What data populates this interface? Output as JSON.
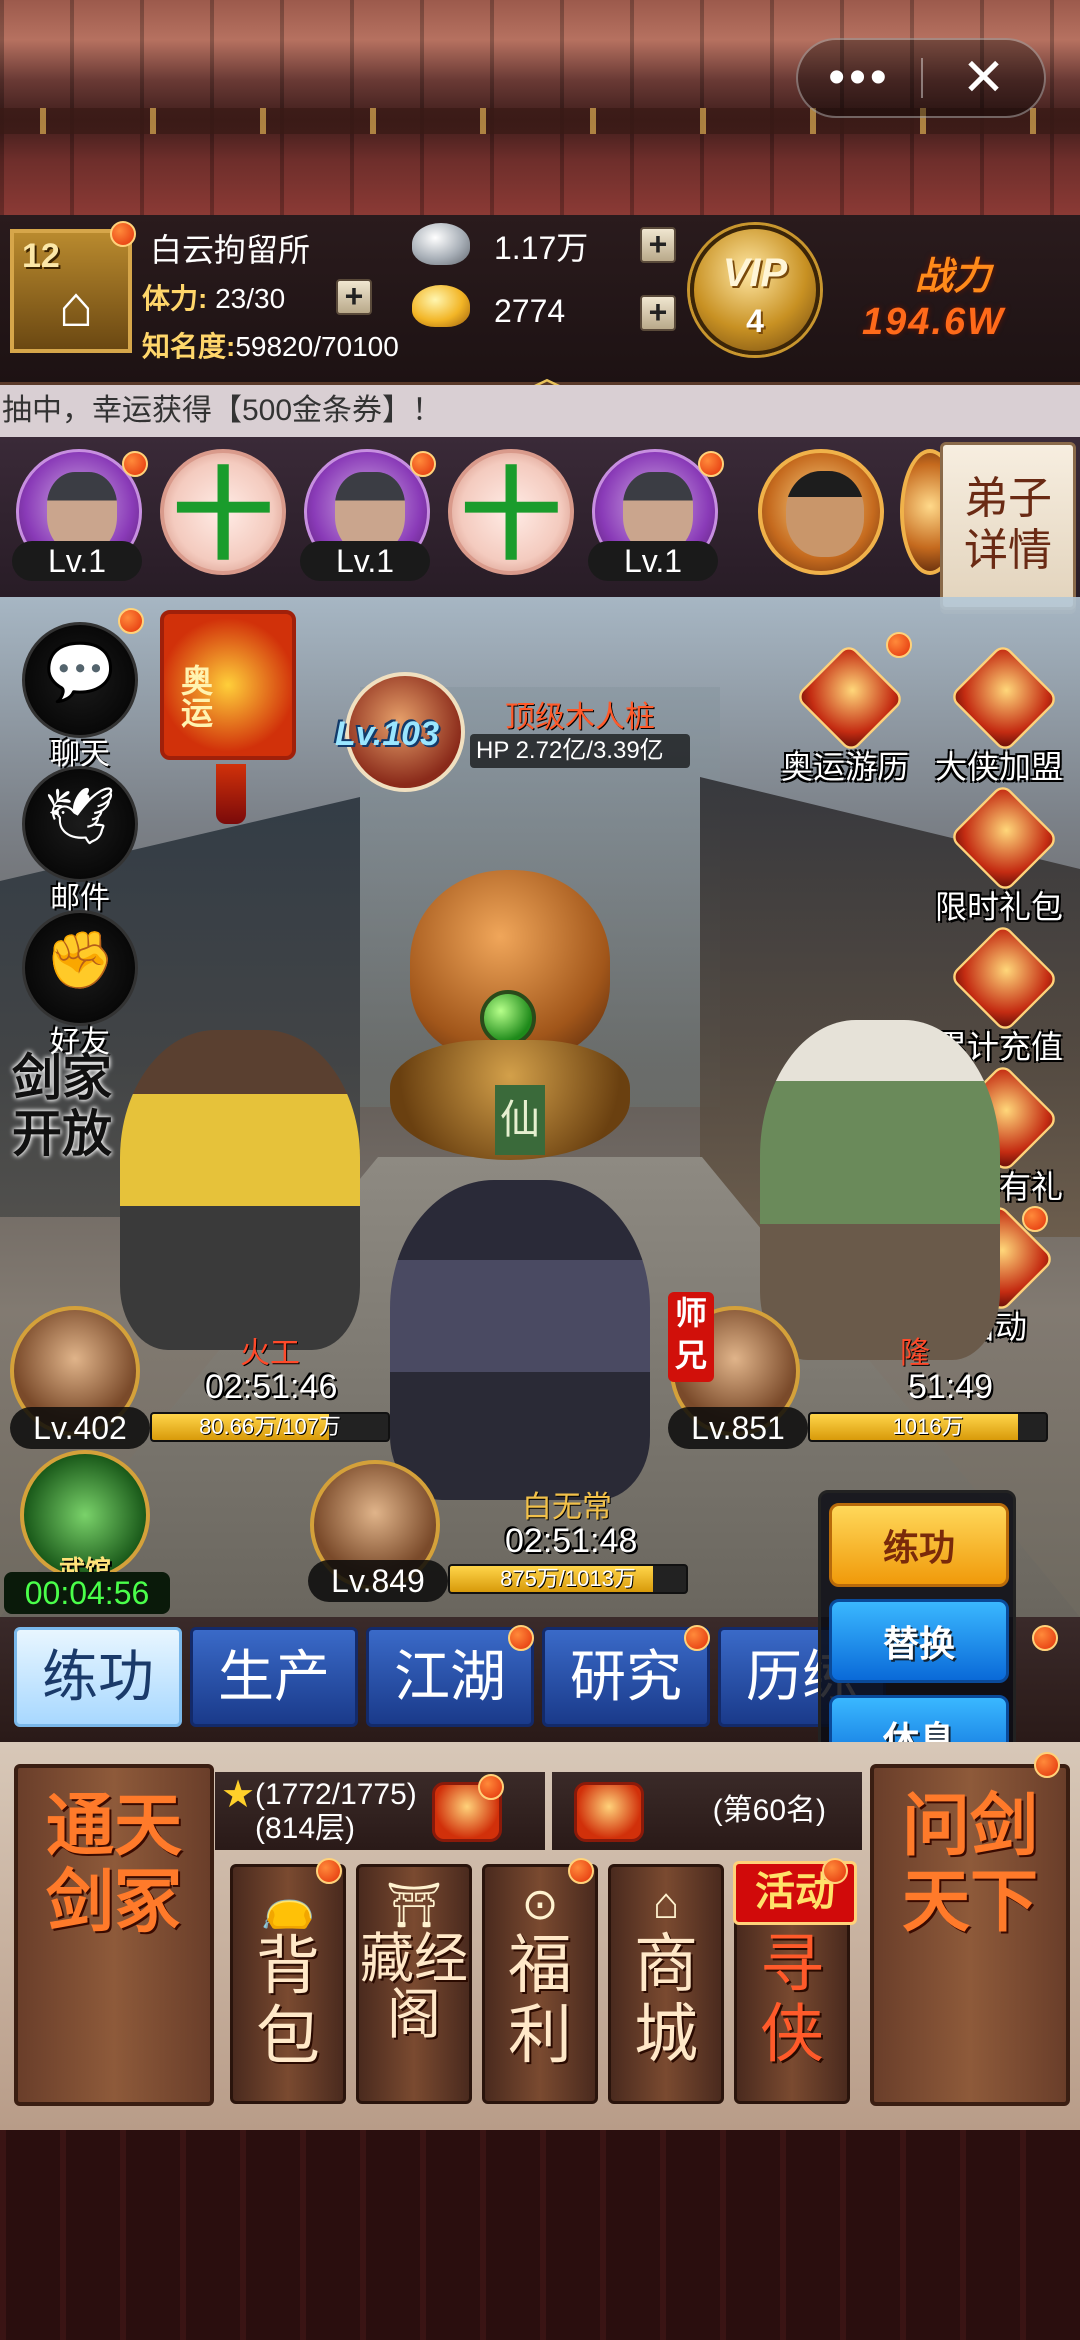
{
  "window_controls": {
    "more": "•••",
    "close": "✕"
  },
  "player": {
    "level": "12",
    "name": "白云拘留所",
    "stamina_label": "体力:",
    "stamina_value": "23/30",
    "fame_label": "知名度:",
    "fame_value": "59820/70100"
  },
  "currency": {
    "silver": "1.17万",
    "gold": "2774",
    "plus": "+"
  },
  "vip": {
    "label": "VIP",
    "level": "4"
  },
  "power": {
    "label": "战力",
    "value": "194.6W"
  },
  "marquee": "抽中，幸运获得【500金条券】！",
  "disciples": {
    "slots": [
      {
        "type": "hero",
        "level": "Lv.1"
      },
      {
        "type": "add",
        "symbol": "十"
      },
      {
        "type": "hero",
        "level": "Lv.1"
      },
      {
        "type": "add",
        "symbol": "十"
      },
      {
        "type": "hero",
        "level": "Lv.1"
      },
      {
        "type": "rare"
      }
    ],
    "detail_button": "弟子详情"
  },
  "left_menu": [
    {
      "label": "聊天",
      "icon": "chat-icon"
    },
    {
      "label": "邮件",
      "icon": "dove-icon"
    },
    {
      "label": "好友",
      "icon": "fist-icon"
    }
  ],
  "sword_logo": "剑家开放",
  "olympic_badge": "奥运",
  "boss": {
    "level": "Lv.103",
    "name": "顶级木人桩",
    "hp": "HP 2.72亿/3.39亿"
  },
  "right_menu": [
    {
      "label": "奥运游历"
    },
    {
      "label": "大侠加盟"
    },
    {
      "label": "限时礼包"
    },
    {
      "label": "累计充值"
    },
    {
      "label": "登录有礼"
    },
    {
      "label": "活动"
    }
  ],
  "units": [
    {
      "level": "Lv.402",
      "name": "火工",
      "timer": "02:51:46",
      "hp": "80.66万/107万",
      "fill": 0.75
    },
    {
      "level": "Lv.849",
      "name": "白无常",
      "timer": "02:51:48",
      "hp": "875万/1013万",
      "fill": 0.86
    },
    {
      "level": "Lv.851",
      "name": "隆",
      "timer": "51:49",
      "hp": "1016万",
      "fill": 0.88,
      "tag": "师兄"
    }
  ],
  "dojo": {
    "label": "武馆",
    "timer": "00:04:56"
  },
  "actions": {
    "train": "练功",
    "replace": "替换",
    "rest": "休息"
  },
  "tabs": [
    "练功",
    "生产",
    "江湖",
    "研究",
    "历练"
  ],
  "bottom": {
    "left_scroll": "通天剑冢",
    "progress_top": "(1772/1775)",
    "progress_bottom": "(814层)",
    "rank": "(第60名)",
    "right_scroll": "问剑天下",
    "items": [
      {
        "label": "背包",
        "icon": "bag-icon"
      },
      {
        "label": "藏经阁",
        "icon": "pavilion-icon"
      },
      {
        "label": "福利",
        "icon": "coin-icon"
      },
      {
        "label": "商城",
        "icon": "shop-icon"
      },
      {
        "label": "寻侠",
        "tag": "活动"
      }
    ]
  }
}
